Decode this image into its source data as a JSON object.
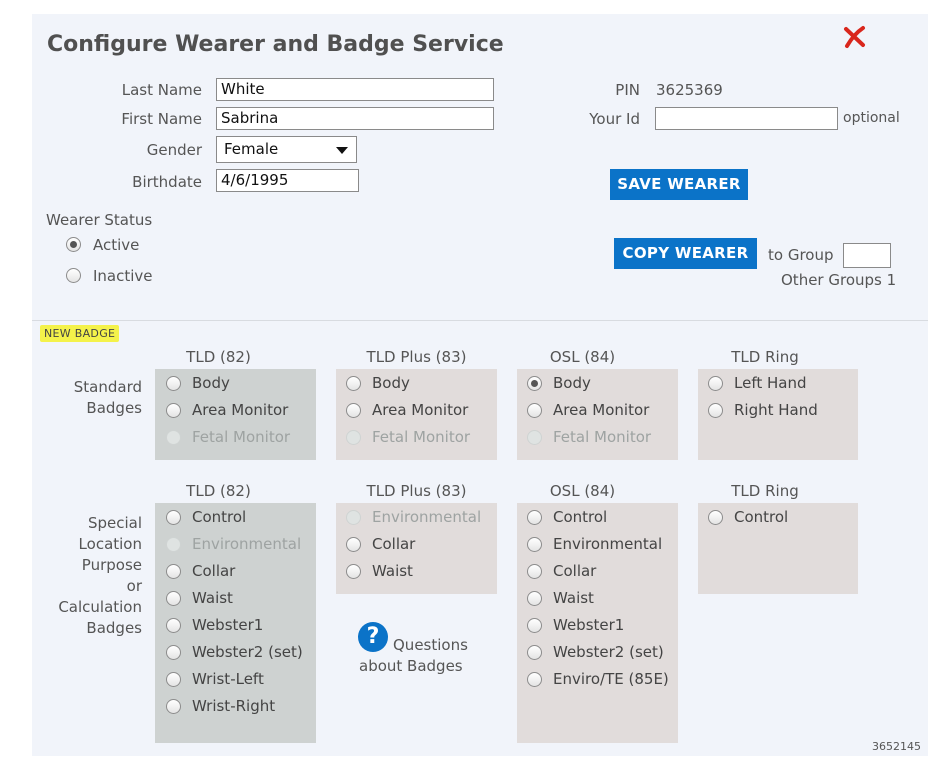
{
  "dialog": {
    "title": "Configure Wearer and Badge Service",
    "close_icon": "close-x-icon"
  },
  "form": {
    "last_name_label": "Last Name",
    "last_name_value": "White",
    "first_name_label": "First Name",
    "first_name_value": "Sabrina",
    "gender_label": "Gender",
    "gender_value": "Female",
    "birthdate_label": "Birthdate",
    "birthdate_value": "4/6/1995",
    "pin_label": "PIN",
    "pin_value": "3625369",
    "your_id_label": "Your Id",
    "your_id_value": "",
    "optional_label": "optional"
  },
  "actions": {
    "save_label": "SAVE WEARER",
    "copy_label": "COPY WEARER",
    "to_group_label": "to Group",
    "to_group_value": "",
    "other_groups_label": "Other Groups 1"
  },
  "status": {
    "label": "Wearer Status",
    "active_label": "Active",
    "inactive_label": "Inactive",
    "selected": "Active"
  },
  "badges": {
    "new_badge_label": "NEW BADGE",
    "standard_label_1": "Standard",
    "standard_label_2": "Badges",
    "special_label_1": "Special",
    "special_label_2": "Location",
    "special_label_3": "Purpose",
    "special_label_4": "or",
    "special_label_5": "Calculation",
    "special_label_6": "Badges",
    "col_tld": "TLD (82)",
    "col_tldplus": "TLD Plus (83)",
    "col_osl": "OSL (84)",
    "col_ring": "TLD Ring",
    "standard": {
      "tld": [
        "Body",
        "Area Monitor",
        "Fetal Monitor"
      ],
      "tldplus": [
        "Body",
        "Area Monitor",
        "Fetal Monitor"
      ],
      "osl": [
        "Body",
        "Area Monitor",
        "Fetal Monitor"
      ],
      "ring": [
        "Left Hand",
        "Right Hand"
      ],
      "selected": "OSL Body"
    },
    "special": {
      "tld": [
        "Control",
        "Environmental",
        "Collar",
        "Waist",
        "Webster1",
        "Webster2 (set)",
        "Wrist-Left",
        "Wrist-Right"
      ],
      "tldplus": [
        "Environmental",
        "Collar",
        "Waist"
      ],
      "osl": [
        "Control",
        "Environmental",
        "Collar",
        "Waist",
        "Webster1",
        "Webster2 (set)",
        "Enviro/TE (85E)"
      ],
      "ring": [
        "Control"
      ]
    },
    "help_icon": "question-mark-icon",
    "help_text_1": "Questions",
    "help_text_2": "about Badges"
  },
  "footer": {
    "id": "3652145"
  },
  "colors": {
    "accent": "#0b73c8",
    "panel": "#f1f4fa",
    "highlight": "#f4f24a",
    "close": "#d9261c"
  }
}
